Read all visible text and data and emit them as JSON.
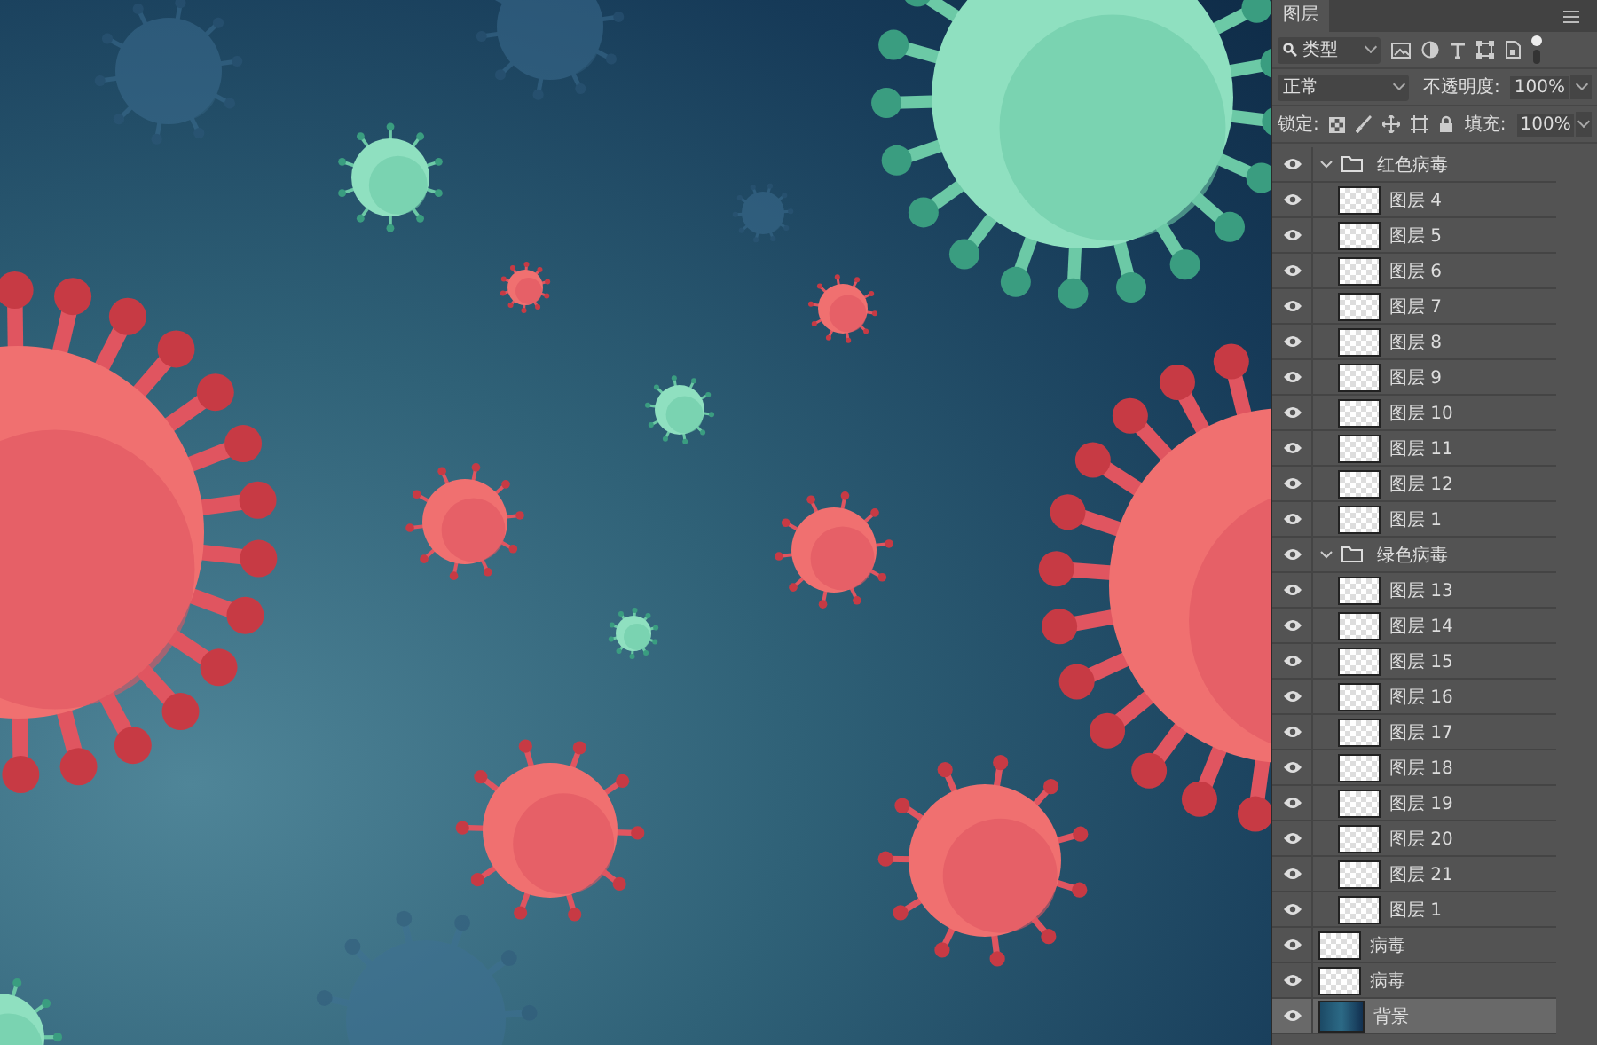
{
  "panel": {
    "tab": "图层",
    "filter": "类型",
    "blend_mode": "正常",
    "opacity_label": "不透明度:",
    "opacity": "100%",
    "lock_label": "锁定:",
    "fill_label": "填充:",
    "fill": "100%"
  },
  "layers": [
    {
      "kind": "group",
      "name": "红色病毒",
      "visible": true,
      "expanded": true,
      "selected": false,
      "children": [
        {
          "kind": "layer",
          "name": "图层 4",
          "visible": true,
          "selected": false
        },
        {
          "kind": "layer",
          "name": "图层 5",
          "visible": true,
          "selected": false
        },
        {
          "kind": "layer",
          "name": "图层 6",
          "visible": true,
          "selected": false
        },
        {
          "kind": "layer",
          "name": "图层 7",
          "visible": true,
          "selected": false
        },
        {
          "kind": "layer",
          "name": "图层 8",
          "visible": true,
          "selected": false
        },
        {
          "kind": "layer",
          "name": "图层 9",
          "visible": true,
          "selected": false
        },
        {
          "kind": "layer",
          "name": "图层 10",
          "visible": true,
          "selected": false
        },
        {
          "kind": "layer",
          "name": "图层 11",
          "visible": true,
          "selected": false
        },
        {
          "kind": "layer",
          "name": "图层 12",
          "visible": true,
          "selected": false
        },
        {
          "kind": "layer",
          "name": "图层 1",
          "visible": true,
          "selected": false
        }
      ]
    },
    {
      "kind": "group",
      "name": "绿色病毒",
      "visible": true,
      "expanded": true,
      "selected": false,
      "children": [
        {
          "kind": "layer",
          "name": "图层 13",
          "visible": true,
          "selected": false
        },
        {
          "kind": "layer",
          "name": "图层 14",
          "visible": true,
          "selected": false
        },
        {
          "kind": "layer",
          "name": "图层 15",
          "visible": true,
          "selected": false
        },
        {
          "kind": "layer",
          "name": "图层 16",
          "visible": true,
          "selected": false
        },
        {
          "kind": "layer",
          "name": "图层 17",
          "visible": true,
          "selected": false
        },
        {
          "kind": "layer",
          "name": "图层 18",
          "visible": true,
          "selected": false
        },
        {
          "kind": "layer",
          "name": "图层 19",
          "visible": true,
          "selected": false
        },
        {
          "kind": "layer",
          "name": "图层 20",
          "visible": true,
          "selected": false
        },
        {
          "kind": "layer",
          "name": "图层 21",
          "visible": true,
          "selected": false
        },
        {
          "kind": "layer",
          "name": "图层 1",
          "visible": true,
          "selected": false
        }
      ]
    },
    {
      "kind": "layer",
      "name": "病毒",
      "visible": true,
      "selected": false
    },
    {
      "kind": "layer",
      "name": "病毒",
      "visible": true,
      "selected": false
    },
    {
      "kind": "background",
      "name": "背景",
      "visible": true,
      "selected": true
    }
  ]
}
